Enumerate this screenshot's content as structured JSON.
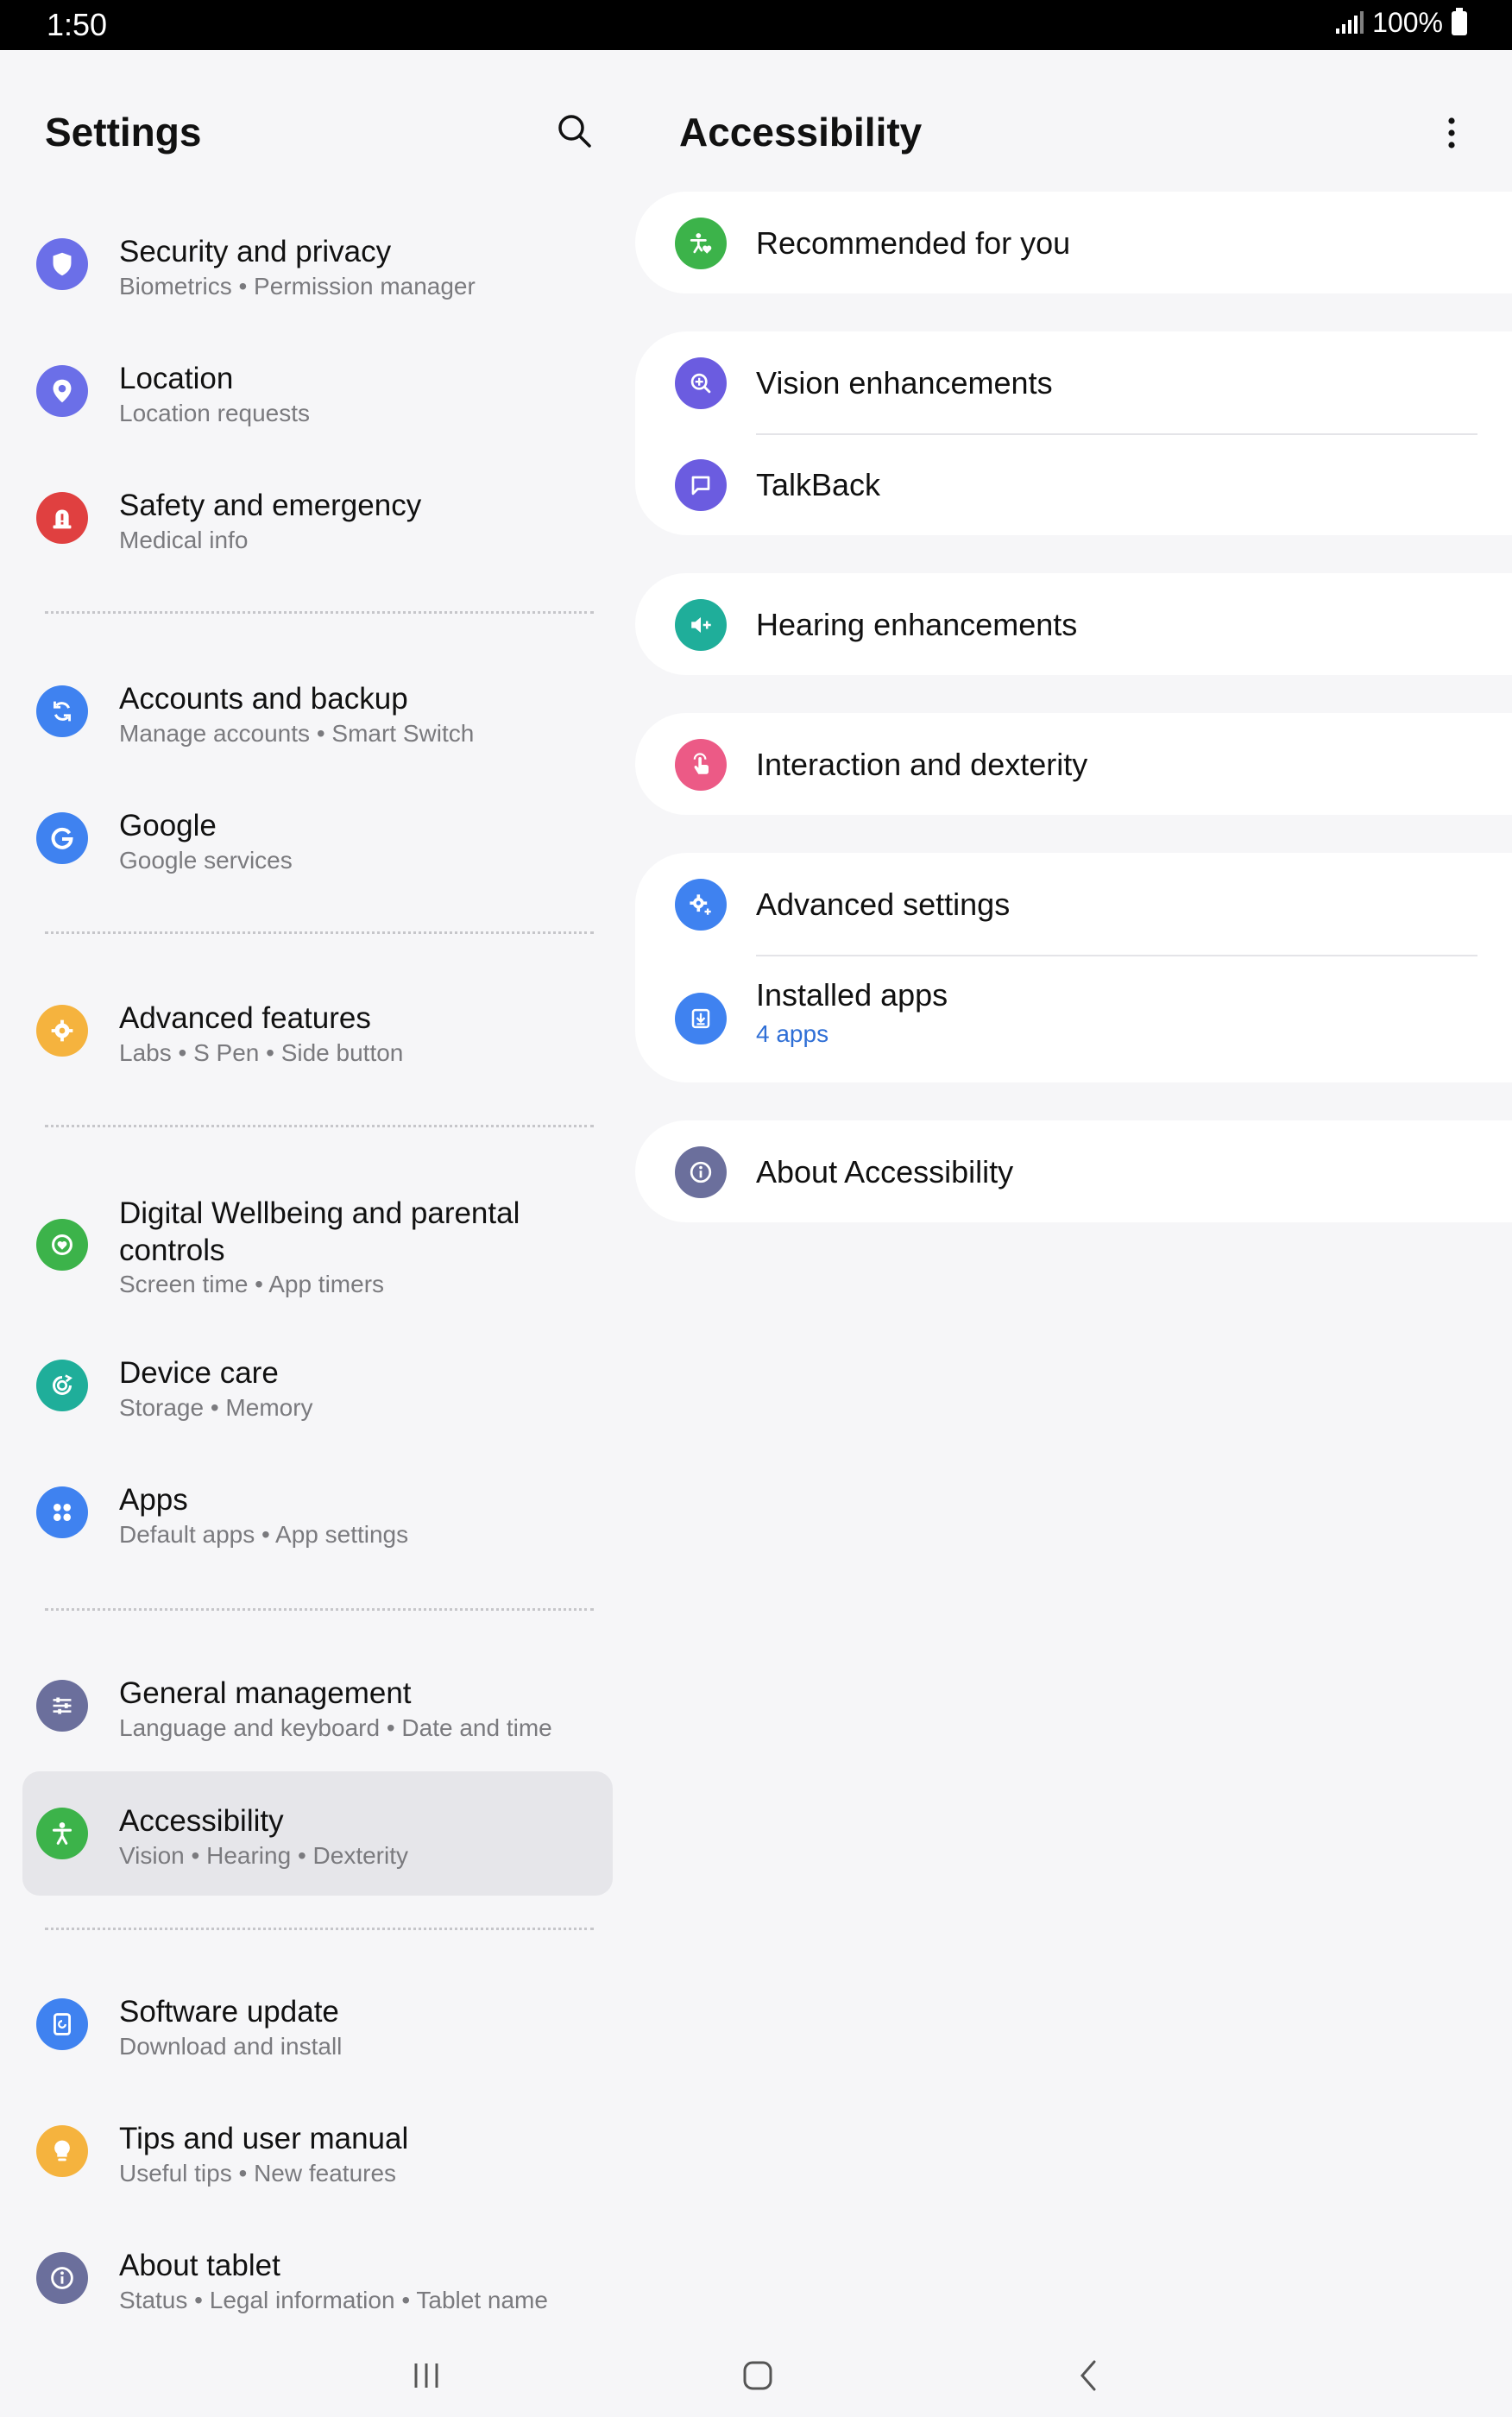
{
  "status_bar": {
    "time": "1:50",
    "battery": "100%"
  },
  "left_pane": {
    "title": "Settings",
    "items": [
      {
        "title": "Security and privacy",
        "sub": "Biometrics  •  Permission manager",
        "icon": "shield-icon",
        "color": "#6b6fe8"
      },
      {
        "title": "Location",
        "sub": "Location requests",
        "icon": "location-pin-icon",
        "color": "#6b6fe8"
      },
      {
        "title": "Safety and emergency",
        "sub": "Medical info",
        "icon": "emergency-siren-icon",
        "color": "#e04040"
      },
      {
        "title": "Accounts and backup",
        "sub": "Manage accounts  •  Smart Switch",
        "icon": "sync-icon",
        "color": "#3f82f0"
      },
      {
        "title": "Google",
        "sub": "Google services",
        "icon": "google-g-icon",
        "color": "#3f82f0"
      },
      {
        "title": "Advanced features",
        "sub": "Labs  •  S Pen  •  Side button",
        "icon": "puzzle-gear-icon",
        "color": "#f5b33e"
      },
      {
        "title": "Digital Wellbeing and parental controls",
        "sub": "Screen time  •  App timers",
        "icon": "heart-ring-icon",
        "color": "#3cb34a"
      },
      {
        "title": "Device care",
        "sub": "Storage  •  Memory",
        "icon": "device-care-icon",
        "color": "#1fae9a"
      },
      {
        "title": "Apps",
        "sub": "Default apps  •  App settings",
        "icon": "apps-grid-icon",
        "color": "#3f82f0"
      },
      {
        "title": "General management",
        "sub": "Language and keyboard  •  Date and time",
        "icon": "sliders-icon",
        "color": "#6b6f9c"
      },
      {
        "title": "Accessibility",
        "sub": "Vision  •  Hearing  •  Dexterity",
        "icon": "accessibility-person-icon",
        "color": "#3cb34a"
      },
      {
        "title": "Software update",
        "sub": "Download and install",
        "icon": "software-update-icon",
        "color": "#3f82f0"
      },
      {
        "title": "Tips and user manual",
        "sub": "Useful tips  •  New features",
        "icon": "lightbulb-icon",
        "color": "#f5b33e"
      },
      {
        "title": "About tablet",
        "sub": "Status  •  Legal information  •  Tablet name",
        "icon": "info-icon",
        "color": "#6b6f9c"
      }
    ]
  },
  "right_pane": {
    "title": "Accessibility",
    "rows": {
      "recommended": {
        "label": "Recommended for you",
        "icon": "accessibility-heart-icon",
        "color": "#3cb34a"
      },
      "vision": {
        "label": "Vision enhancements",
        "icon": "magnifier-plus-icon",
        "color": "#6b5ce0"
      },
      "talkback": {
        "label": "TalkBack",
        "icon": "speech-bubble-icon",
        "color": "#6b5ce0"
      },
      "hearing": {
        "label": "Hearing enhancements",
        "icon": "speaker-plus-icon",
        "color": "#1fae9a"
      },
      "interaction": {
        "label": "Interaction and dexterity",
        "icon": "touch-hand-icon",
        "color": "#ec5a86"
      },
      "advanced": {
        "label": "Advanced settings",
        "icon": "gear-plus-icon",
        "color": "#3f82f0"
      },
      "installed": {
        "label": "Installed apps",
        "sub": "4 apps",
        "icon": "download-box-icon",
        "color": "#3f82f0"
      },
      "about": {
        "label": "About Accessibility",
        "icon": "info-icon",
        "color": "#6b6f9c"
      }
    }
  },
  "nav_bar": {
    "recents": "recents-icon",
    "home": "home-icon",
    "back": "back-icon"
  }
}
